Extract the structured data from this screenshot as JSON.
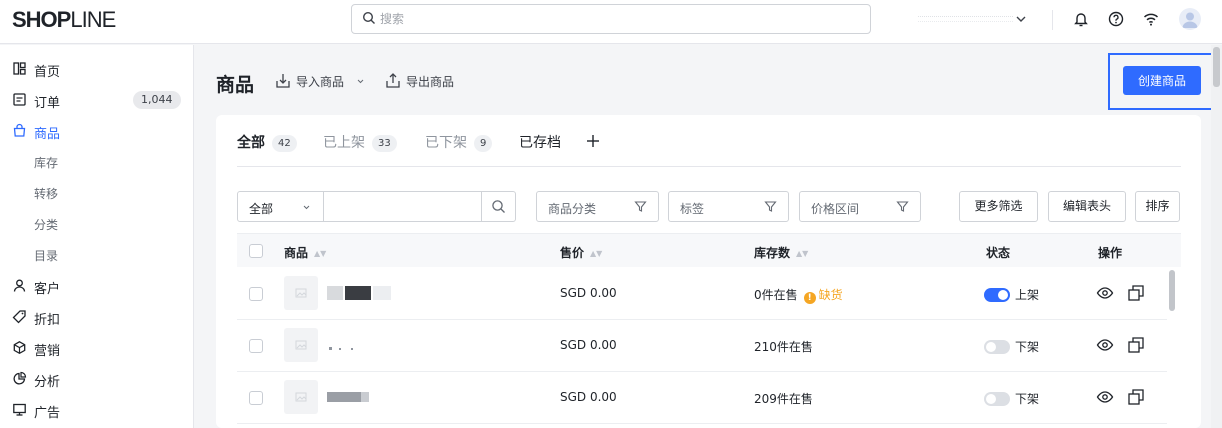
{
  "brand": {
    "logo_bold": "SHOP",
    "logo_thin": "LINE"
  },
  "search": {
    "placeholder": "搜索"
  },
  "header_icons": [
    "bell-icon",
    "help-icon",
    "wifi-icon",
    "avatar"
  ],
  "sidebar": {
    "items": [
      {
        "label": "首页",
        "icon": "dashboard-icon"
      },
      {
        "label": "订单",
        "icon": "order-icon",
        "badge": "1,044"
      },
      {
        "label": "商品",
        "icon": "bag-icon",
        "active": true
      },
      {
        "label": "库存",
        "sub": true
      },
      {
        "label": "转移",
        "sub": true
      },
      {
        "label": "分类",
        "sub": true
      },
      {
        "label": "目录",
        "sub": true
      },
      {
        "label": "客户",
        "icon": "user-icon"
      },
      {
        "label": "折扣",
        "icon": "tag-icon"
      },
      {
        "label": "营销",
        "icon": "cube-icon"
      },
      {
        "label": "分析",
        "icon": "chart-pie-icon"
      },
      {
        "label": "广告",
        "icon": "monitor-icon"
      }
    ]
  },
  "page": {
    "title": "商品",
    "import_label": "导入商品",
    "export_label": "导出商品",
    "create_label": "创建商品"
  },
  "tabs": [
    {
      "label": "全部",
      "count": "42",
      "active": true
    },
    {
      "label": "已上架",
      "count": "33"
    },
    {
      "label": "已下架",
      "count": "9"
    },
    {
      "label": "已存档"
    }
  ],
  "filters": {
    "scope": "全部",
    "category": "商品分类",
    "tag": "标签",
    "price_range": "价格区间",
    "more": "更多筛选",
    "edit_header": "编辑表头",
    "sort": "排序"
  },
  "table": {
    "headers": {
      "product": "商品",
      "price": "售价",
      "stock": "库存数",
      "status": "状态",
      "actions": "操作"
    },
    "rows": [
      {
        "price": "SGD 0.00",
        "stock": "0件在售",
        "warning": "缺货",
        "status": "上架",
        "on": true
      },
      {
        "price": "SGD 0.00",
        "stock": "210件在售",
        "status": "下架",
        "on": false
      },
      {
        "price": "SGD 0.00",
        "stock": "209件在售",
        "status": "下架",
        "on": false
      }
    ]
  },
  "colors": {
    "accent": "#2f6bff",
    "warning": "#f5a623"
  }
}
